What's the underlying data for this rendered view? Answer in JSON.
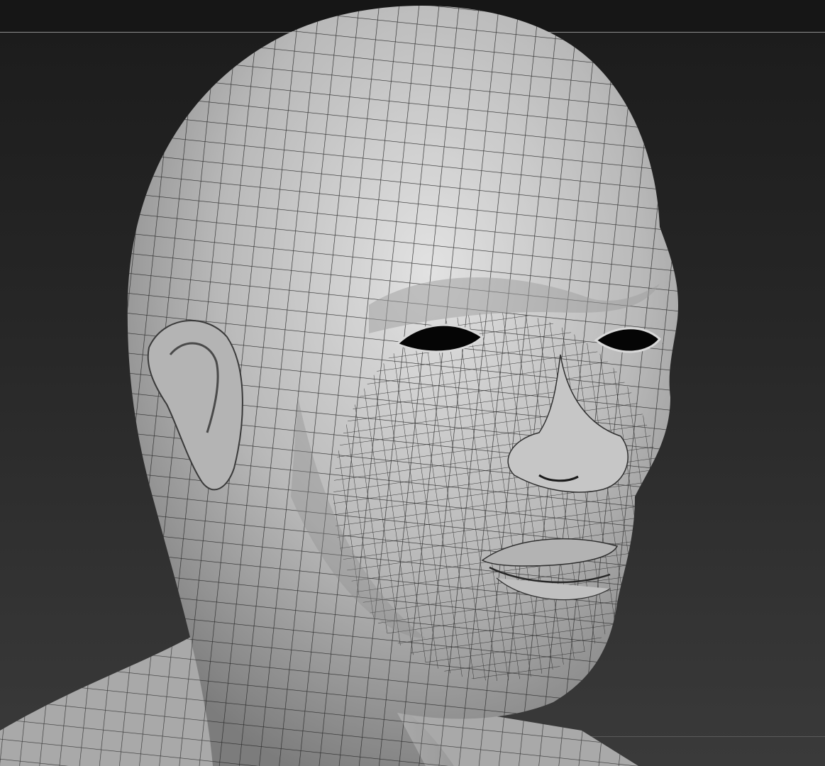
{
  "viewport": {
    "background_top": "#1b1b1b",
    "background_bottom": "#3a3a3a",
    "guide_line_color": "#8a8a8a"
  },
  "model": {
    "subject": "sculpted-head-with-polygroup-wireframe",
    "surface_color": "#c9c9c9",
    "wire_color": "#2a2a2a"
  }
}
